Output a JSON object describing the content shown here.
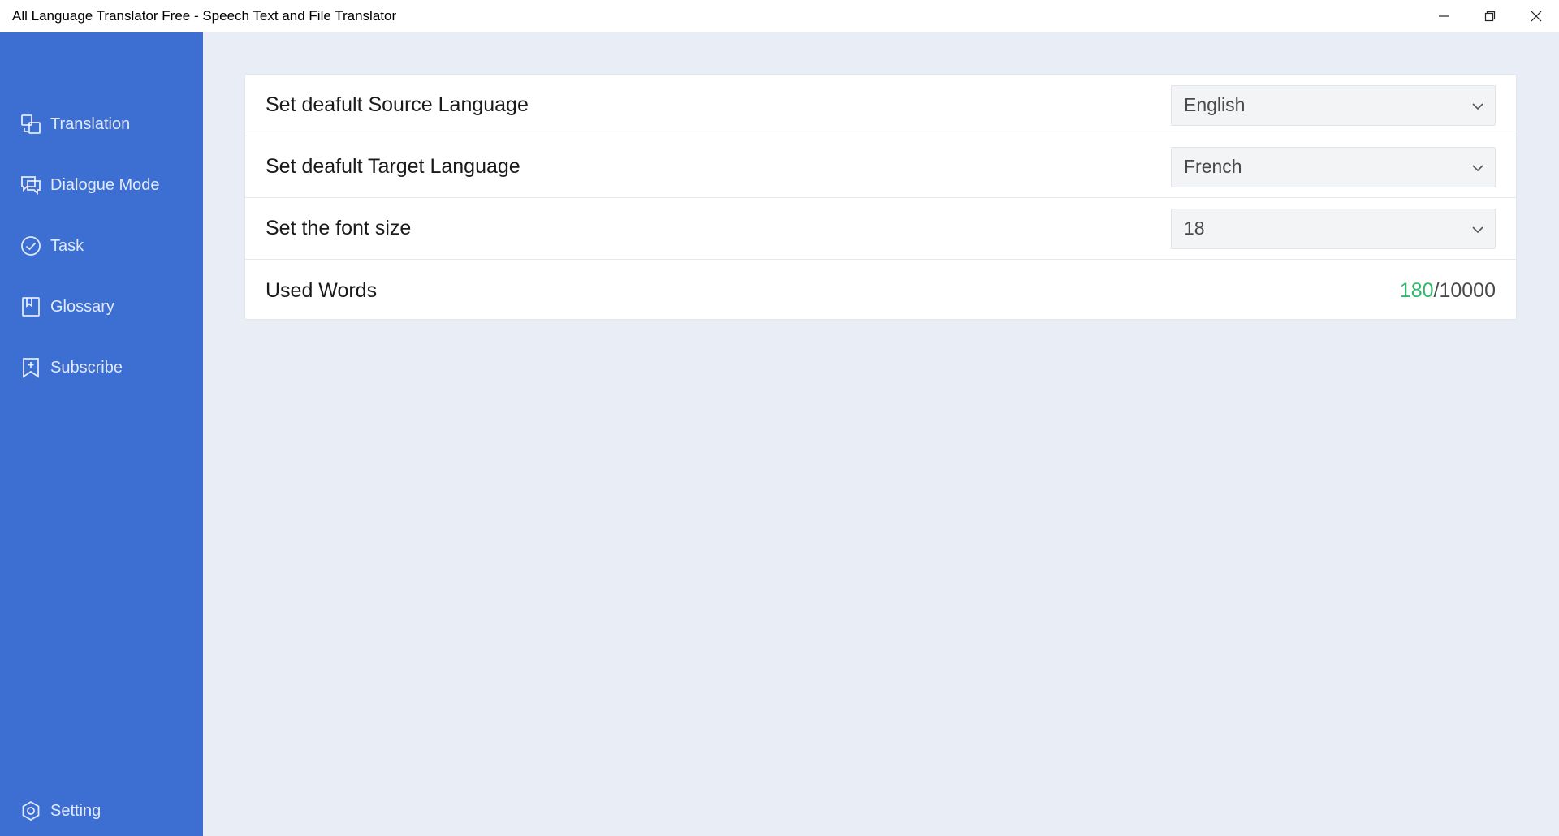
{
  "window": {
    "title": "All Language Translator Free - Speech Text and File Translator",
    "controls": [
      "minimize-icon",
      "restore-icon",
      "close-icon"
    ]
  },
  "sidebar": {
    "background": "#3d6fd3",
    "items": [
      {
        "label": "Translation",
        "icon": "translate-icon"
      },
      {
        "label": "Dialogue Mode",
        "icon": "dialogue-icon"
      },
      {
        "label": "Task",
        "icon": "check-circle-icon"
      },
      {
        "label": "Glossary",
        "icon": "bookmark-icon"
      },
      {
        "label": "Subscribe",
        "icon": "subscribe-icon"
      }
    ],
    "setting": {
      "label": "Setting",
      "icon": "gear-icon"
    }
  },
  "settings": {
    "source_language": {
      "label": "Set deafult Source Language",
      "value": "English"
    },
    "target_language": {
      "label": "Set deafult Target Language",
      "value": "French"
    },
    "font_size": {
      "label": "Set the font size",
      "value": "18"
    },
    "used_words": {
      "label": "Used Words",
      "used": "180",
      "separator": "/",
      "total": "10000",
      "used_color": "#2bbb6a"
    }
  }
}
